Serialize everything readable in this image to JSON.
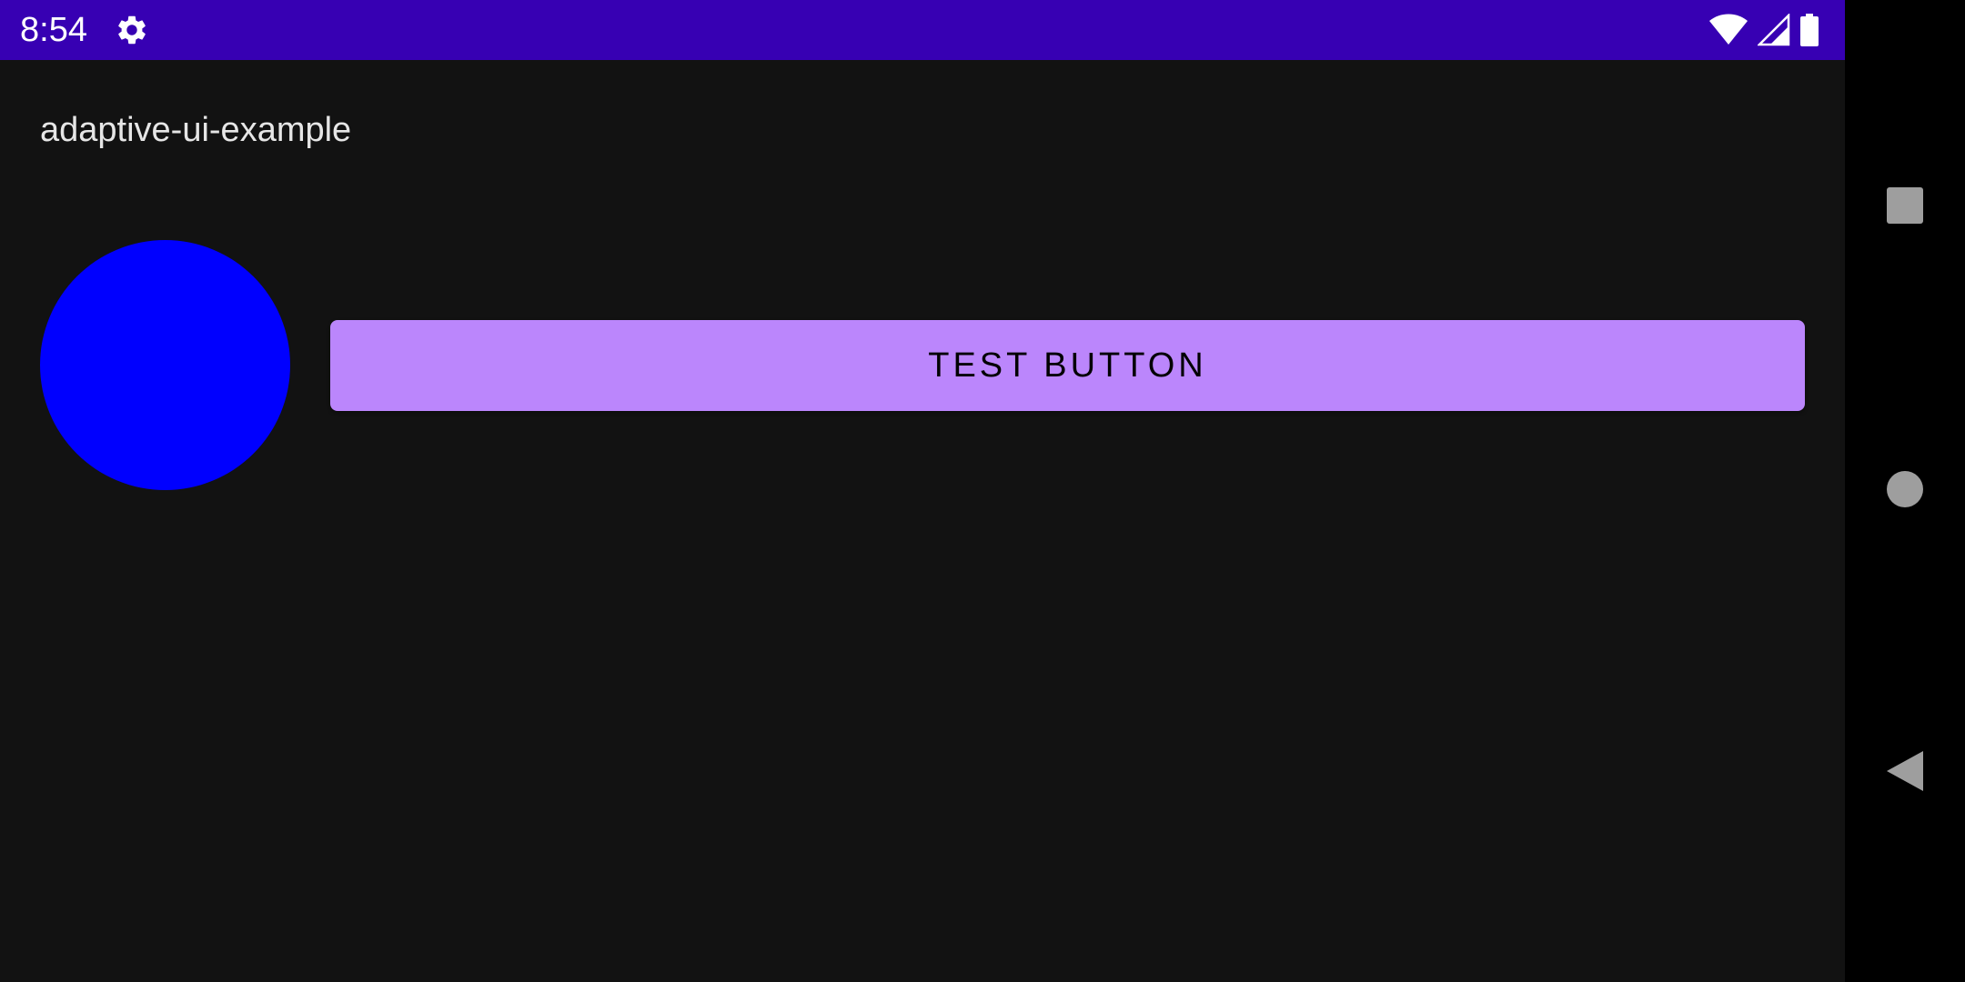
{
  "status_bar": {
    "time": "8:54",
    "background": "#3700b3",
    "icons": [
      "gear-icon",
      "wifi-icon",
      "cell-signal-icon",
      "battery-icon"
    ]
  },
  "app": {
    "title": "adaptive-ui-example",
    "circle_color": "#0000ff",
    "button": {
      "label": "TEST BUTTON",
      "background": "#bb86fc"
    }
  },
  "nav_bar": {
    "icons": [
      "recents-icon",
      "home-icon",
      "back-icon"
    ],
    "icon_color": "#9e9e9e"
  }
}
